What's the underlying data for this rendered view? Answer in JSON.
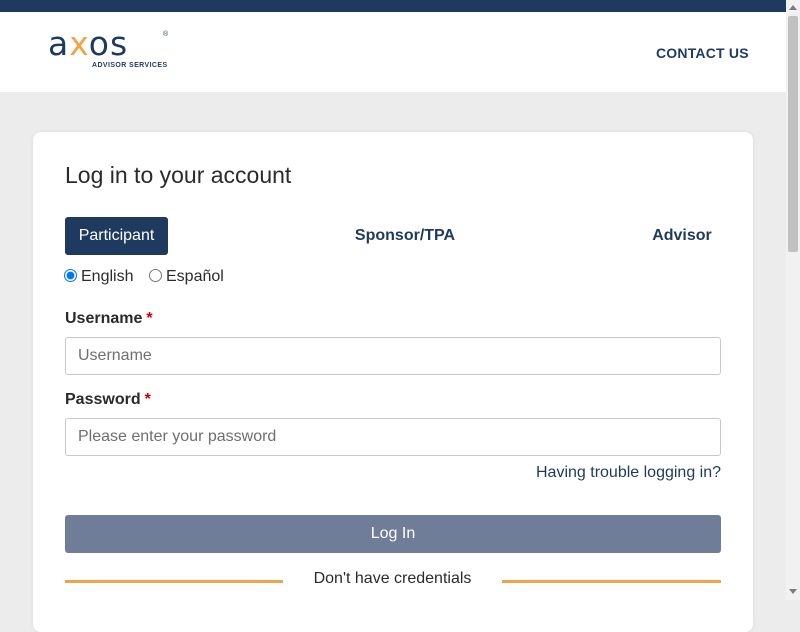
{
  "logo": {
    "wordmark_a": "a",
    "wordmark_x": "x",
    "wordmark_os": "os",
    "subtitle": "ADVISOR SERVICES",
    "registered": "®"
  },
  "header": {
    "contact_label": "CONTACT US"
  },
  "login": {
    "title": "Log in to your account",
    "tabs": [
      {
        "label": "Participant",
        "active": true
      },
      {
        "label": "Sponsor/TPA",
        "active": false
      },
      {
        "label": "Advisor",
        "active": false
      }
    ],
    "languages": [
      {
        "label": "English",
        "selected": true
      },
      {
        "label": "Español",
        "selected": false
      }
    ],
    "username": {
      "label": "Username",
      "required_mark": "*",
      "placeholder": "Username",
      "value": ""
    },
    "password": {
      "label": "Password",
      "required_mark": "*",
      "placeholder": "Please enter your password",
      "value": ""
    },
    "trouble_link": "Having trouble logging in?",
    "submit_label": "Log In",
    "credentials_text": "Don't have credentials"
  },
  "colors": {
    "brand_navy": "#1f3a5f",
    "accent_orange": "#f2a346",
    "button_disabled": "#6f7d98",
    "required_red": "#cc0000"
  }
}
